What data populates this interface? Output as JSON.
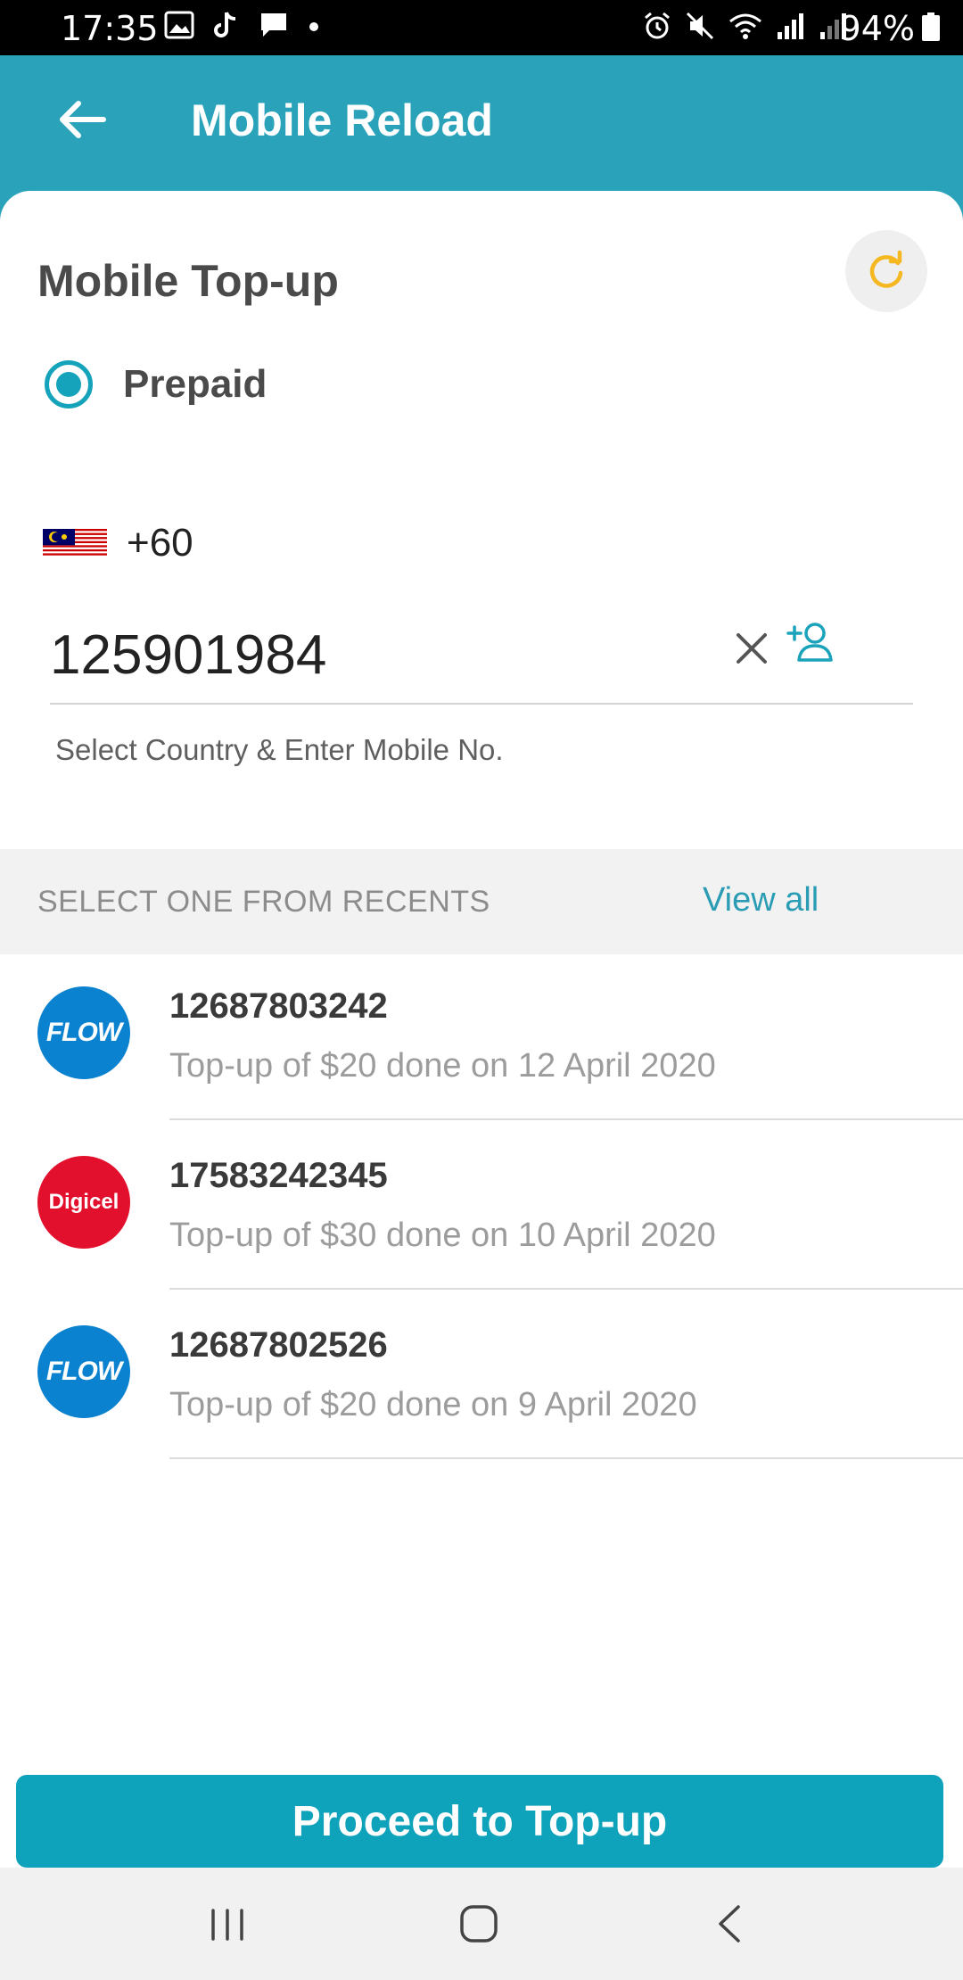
{
  "status_bar": {
    "time": "17:35",
    "battery": "94%"
  },
  "header": {
    "title": "Mobile Reload"
  },
  "topup": {
    "title": "Mobile Top-up",
    "plan_option": "Prepaid",
    "country_code": "+60",
    "mobile_number": "125901984",
    "helper_text": "Select Country & Enter Mobile No."
  },
  "recents": {
    "label": "SELECT ONE FROM RECENTS",
    "view_all": "View all",
    "items": [
      {
        "logo_text": "FLOW",
        "number": "12687803242",
        "desc": "Top-up of $20 done on 12 April 2020"
      },
      {
        "logo_text": "Digicel",
        "number": "17583242345",
        "desc": "Top-up of $30 done on 10 April 2020"
      },
      {
        "logo_text": "FLOW",
        "number": "12687802526",
        "desc": "Top-up of $20 done on 9 April 2020"
      }
    ]
  },
  "proceed_label": "Proceed to Top-up",
  "colors": {
    "header": "#2aa3ba",
    "accent": "#0ea2bb",
    "refresh_icon": "#f5b820",
    "flow_logo": "#0b82cf",
    "digicel_logo": "#e2102c"
  }
}
